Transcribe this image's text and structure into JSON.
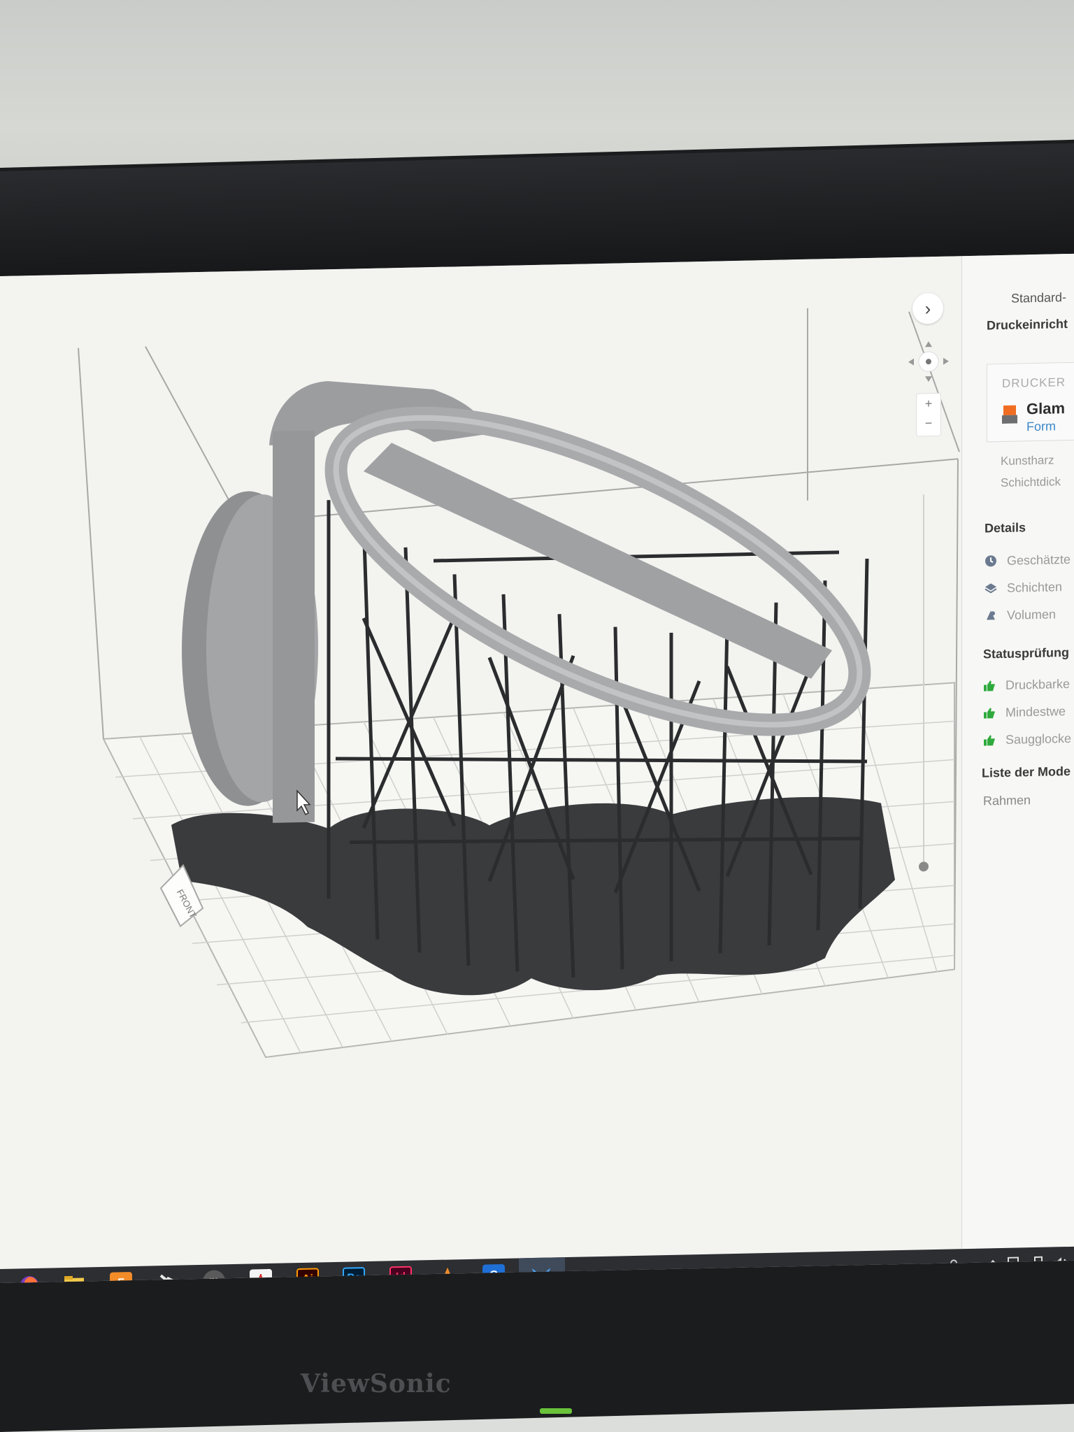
{
  "sidebar": {
    "job_title": "Standard-",
    "print_setup_heading": "Druckeinricht",
    "printer_label": "DRUCKER",
    "printer_name": "Glam",
    "printer_model": "Form",
    "resin_label": "Kunstharz",
    "layer_label": "Schichtdick",
    "details_heading": "Details",
    "details": [
      {
        "icon": "clock-icon",
        "label": "Geschätzte"
      },
      {
        "icon": "layers-icon",
        "label": "Schichten"
      },
      {
        "icon": "volume-icon",
        "label": "Volumen"
      }
    ],
    "status_heading": "Statusprüfung",
    "status_checks": [
      {
        "icon": "thumbs-up-icon",
        "label": "Druckbarke"
      },
      {
        "icon": "thumbs-up-icon",
        "label": "Mindestwe"
      },
      {
        "icon": "thumbs-up-icon",
        "label": "Saugglocke"
      }
    ],
    "models_heading": "Liste der Mode",
    "models": [
      "Rahmen"
    ]
  },
  "viewport": {
    "front_label": "FRONT",
    "nav_toggle": "›",
    "zoom_in": "+",
    "zoom_out": "−"
  },
  "taskbar": {
    "apps": [
      {
        "name": "firefox-icon",
        "glyph": "",
        "color": "#e66000"
      },
      {
        "name": "file-explorer-icon",
        "glyph": "",
        "color": "#f2c94c"
      },
      {
        "name": "fusion-360-icon",
        "glyph": "F",
        "color": "#f28c28"
      },
      {
        "name": "stamp-tool-icon",
        "glyph": "",
        "color": "#e8e8e8"
      },
      {
        "name": "m-app-icon",
        "glyph": "m",
        "color": "#5a5a5a"
      },
      {
        "name": "acrobat-icon",
        "glyph": "",
        "color": "#f4f4f4"
      },
      {
        "name": "illustrator-icon",
        "glyph": "Ai",
        "color": "#330000"
      },
      {
        "name": "photoshop-icon",
        "glyph": "Ps",
        "color": "#001d34"
      },
      {
        "name": "indesign-icon",
        "glyph": "Id",
        "color": "#49021f"
      },
      {
        "name": "vlc-icon",
        "glyph": "",
        "color": "#f28c28"
      },
      {
        "name": "c-app-icon",
        "glyph": "C",
        "color": "#1f6fd6"
      },
      {
        "name": "preform-icon",
        "glyph": "",
        "color": "#2d87d8"
      }
    ]
  },
  "monitor": {
    "brand": "ViewSonic"
  }
}
